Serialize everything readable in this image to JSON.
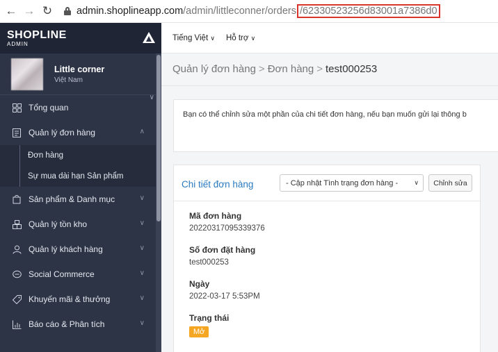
{
  "browser": {
    "url_host": "admin.shoplineapp.com",
    "url_path": "/admin/littleconner/orders",
    "url_highlight": "/62330523256d83001a7386d0"
  },
  "sidebar": {
    "logo_brand": "SHOPLINE",
    "logo_sub": "ADMIN",
    "store_name": "Little corner",
    "store_country": "Việt Nam",
    "items": [
      {
        "label": "Tổng quan",
        "icon": "dashboard-icon"
      },
      {
        "label": "Quản lý đơn hàng",
        "icon": "clipboard-icon",
        "expanded": true
      },
      {
        "label": "Sản phẩm & Danh mục",
        "icon": "bag-icon"
      },
      {
        "label": "Quản lý tồn kho",
        "icon": "inventory-icon"
      },
      {
        "label": "Quản lý khách hàng",
        "icon": "user-icon"
      },
      {
        "label": "Social Commerce",
        "icon": "chat-icon"
      },
      {
        "label": "Khuyến mãi & thưởng",
        "icon": "tag-icon"
      },
      {
        "label": "Báo cáo & Phân tích",
        "icon": "chart-icon"
      }
    ],
    "subitems": [
      "Đơn hàng",
      "Sự mua dài hạn Sản phẩm"
    ]
  },
  "topbar": {
    "language": "Tiếng Việt",
    "support": "Hỗ trợ"
  },
  "breadcrumb": {
    "level1": "Quản lý đơn hàng",
    "level2": "Đơn hàng",
    "current": "test000253",
    "separator": ">"
  },
  "notice": {
    "text": "Bạn có thể chỉnh sửa một phần của chi tiết đơn hàng, nếu bạn muốn gửi lại thông b"
  },
  "order_card": {
    "title": "Chi tiết đơn hàng",
    "status_select": "- Cập nhật Tình trạng đơn hàng -",
    "edit_button": "Chỉnh sửa",
    "fields": [
      {
        "label": "Mã đơn hàng",
        "value": "20220317095339376"
      },
      {
        "label": "Số đơn đặt hàng",
        "value": "test000253"
      },
      {
        "label": "Ngày",
        "value": "2022-03-17 5:53PM"
      }
    ],
    "status_label": "Trạng thái",
    "status_value": "Mở"
  },
  "colors": {
    "sidebar_bg": "#2d3446",
    "link_blue": "#2a7ac0",
    "badge_orange": "#f5a623",
    "highlight_red": "#d9342b"
  }
}
